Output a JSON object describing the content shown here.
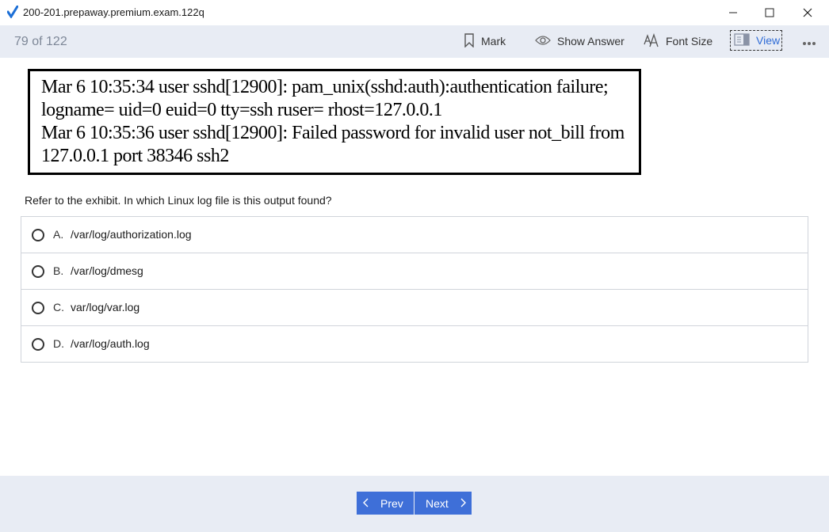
{
  "window": {
    "title": "200-201.prepaway.premium.exam.122q"
  },
  "toolbar": {
    "progress": "79 of 122",
    "mark_label": "Mark",
    "show_answer_label": "Show Answer",
    "font_size_label": "Font Size",
    "view_label": "View"
  },
  "exhibit": {
    "lines": [
      "Mar 6 10:35:34 user sshd[12900]: pam_unix(sshd:auth):authentication failure;",
      "logname= uid=0 euid=0 tty=ssh ruser= rhost=127.0.0.1",
      "Mar 6 10:35:36 user sshd[12900]: Failed password for invalid user not_bill from",
      "127.0.0.1 port 38346 ssh2"
    ]
  },
  "question": {
    "text": "Refer to the exhibit. In which Linux log file is this output found?",
    "options": [
      {
        "letter": "A.",
        "text": "/var/log/authorization.log"
      },
      {
        "letter": "B.",
        "text": "/var/log/dmesg"
      },
      {
        "letter": "C.",
        "text": "var/log/var.log"
      },
      {
        "letter": "D.",
        "text": "/var/log/auth.log"
      }
    ]
  },
  "footer": {
    "prev_label": "Prev",
    "next_label": "Next"
  },
  "colors": {
    "accent": "#3e6fd8",
    "toolbar_bg": "#e8ecf4",
    "view_active": "#2f6cd6"
  },
  "icons": {
    "app": "checkmark-icon",
    "mark": "bookmark-icon",
    "show_answer": "eye-icon",
    "font_size": "font-size-icon",
    "view": "view-layout-icon",
    "more": "more-dots-icon"
  }
}
